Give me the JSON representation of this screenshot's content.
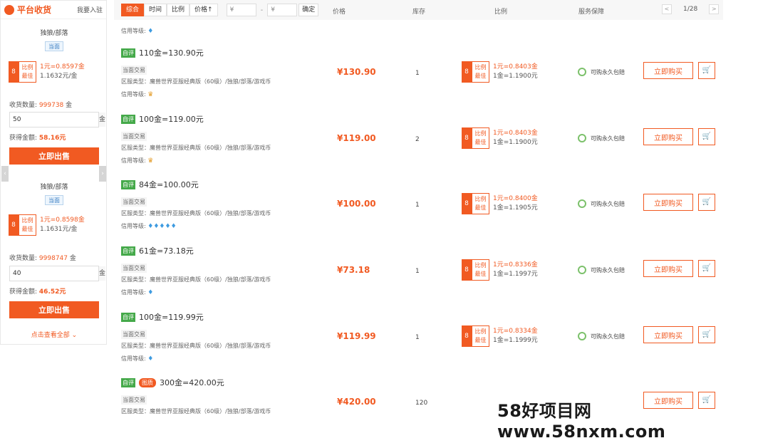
{
  "sidebar": {
    "title": "平台收货",
    "join": "我要入驻",
    "see_all": "点击查看全部",
    "offers": [
      {
        "race": "独狼/部落",
        "tag": "当面",
        "best_label1": "比例",
        "best_label2": "最佳",
        "rate1": "1元=0.8597金",
        "rate2": "1.1632元/金",
        "qty_label": "收货数量:",
        "qty_value": "999738",
        "qty_unit": "金",
        "input": "50",
        "input_unit": "金",
        "get_label": "获得金额:",
        "get_value": "58.16元",
        "sell": "立即出售"
      },
      {
        "race": "独狼/部落",
        "tag": "当面",
        "best_label1": "比例",
        "best_label2": "最佳",
        "rate1": "1元=0.8598金",
        "rate2": "1.1631元/金",
        "qty_label": "收货数量:",
        "qty_value": "9998747",
        "qty_unit": "金",
        "input": "40",
        "input_unit": "金",
        "get_label": "获得金额:",
        "get_value": "46.52元",
        "sell": "立即出售"
      }
    ]
  },
  "toolbar": {
    "sorts": [
      "综合",
      "时间",
      "比例",
      "价格↑"
    ],
    "min_placeholder": "¥",
    "dash": "-",
    "max_placeholder": "¥",
    "confirm": "确定",
    "headers": {
      "price": "价格",
      "stock": "库存",
      "ratio": "比例",
      "service": "服务保障"
    },
    "page": "1/28",
    "prev": "<",
    "next": ">"
  },
  "credit_top": "信用等级:",
  "listings": [
    {
      "badge": "自评",
      "pic": "",
      "title": "110金=130.90元",
      "trade": "当面交易",
      "server": "区服类型：魔兽世界亚服经典版（60级）/独狼/部落/游戏币",
      "credit": "信用等级:",
      "credit_icon": "♛",
      "credit_count": 1,
      "price": "¥130.90",
      "stock": "1",
      "rate1": "1元=0.8403金",
      "rate2": "1金=1.1900元",
      "service": "可购永久包赔",
      "buy": "立即购买"
    },
    {
      "badge": "自评",
      "pic": "",
      "title": "100金=119.00元",
      "trade": "当面交易",
      "server": "区服类型：魔兽世界亚服经典版（60级）/独狼/部落/游戏币",
      "credit": "信用等级:",
      "credit_icon": "♛",
      "credit_count": 1,
      "price": "¥119.00",
      "stock": "2",
      "rate1": "1元=0.8403金",
      "rate2": "1金=1.1900元",
      "service": "可购永久包赔",
      "buy": "立即购买"
    },
    {
      "badge": "自评",
      "pic": "",
      "title": "84金=100.00元",
      "trade": "当面交易",
      "server": "区服类型：魔兽世界亚服经典版（60级）/独狼/部落/游戏币",
      "credit": "信用等级:",
      "credit_icon": "♦",
      "credit_count": 5,
      "price": "¥100.00",
      "stock": "1",
      "rate1": "1元=0.8400金",
      "rate2": "1金=1.1905元",
      "service": "可购永久包赔",
      "buy": "立即购买"
    },
    {
      "badge": "自评",
      "pic": "",
      "title": "61金=73.18元",
      "trade": "当面交易",
      "server": "区服类型：魔兽世界亚服经典版（60级）/独狼/部落/游戏币",
      "credit": "信用等级:",
      "credit_icon": "♦",
      "credit_count": 1,
      "price": "¥73.18",
      "stock": "1",
      "rate1": "1元=0.8336金",
      "rate2": "1金=1.1997元",
      "service": "可购永久包赔",
      "buy": "立即购买"
    },
    {
      "badge": "自评",
      "pic": "",
      "title": "100金=119.99元",
      "trade": "当面交易",
      "server": "区服类型：魔兽世界亚服经典版（60级）/独狼/部落/游戏币",
      "credit": "信用等级:",
      "credit_icon": "♦",
      "credit_count": 1,
      "price": "¥119.99",
      "stock": "1",
      "rate1": "1元=0.8334金",
      "rate2": "1金=1.1999元",
      "service": "可购永久包赔",
      "buy": "立即购买"
    },
    {
      "badge": "自评",
      "pic": "图质",
      "title": "300金=420.00元",
      "trade": "当面交易",
      "server": "区服类型：魔兽世界亚服经典版（60级）/独狼/部落/游戏币",
      "credit": "",
      "credit_icon": "♦",
      "credit_count": 0,
      "price": "¥420.00",
      "stock": "120",
      "rate1": "",
      "rate2": "",
      "service": "",
      "buy": "立即购买"
    }
  ],
  "watermark": "58好项目网www.58nxm.com",
  "colors": {
    "accent": "#f15a22",
    "gem": "#3e9be0",
    "crown": "#e39a24",
    "auto": "#45a94a"
  }
}
